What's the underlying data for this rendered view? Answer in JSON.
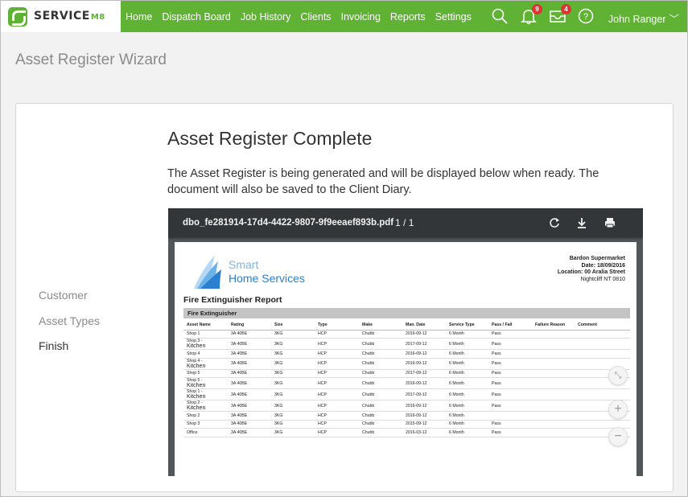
{
  "brand": {
    "name": "SERVICE",
    "suffix": "M8"
  },
  "nav": {
    "items": [
      "Home",
      "Dispatch Board",
      "Job History",
      "Clients",
      "Invoicing",
      "Reports",
      "Settings"
    ],
    "notifications_count": "9",
    "messages_count": "4",
    "user_name": "John Ranger",
    "chevron": "﹀"
  },
  "page": {
    "title": "Asset Register Wizard"
  },
  "wizard": {
    "steps": [
      "Customer",
      "Asset Types",
      "Finish"
    ],
    "active_step": "Finish",
    "heading": "Asset Register Complete",
    "description": "The Asset Register is being generated and will be displayed below when ready. The document will also be saved to the Client Diary."
  },
  "viewer": {
    "filename": "dbo_fe281914-17d4-4422-9807-9f9eeaef893b.pdf",
    "page_current": "1",
    "page_total": "1",
    "page_separator": "/",
    "zoom_in": "+",
    "zoom_out": "−"
  },
  "report": {
    "company_line1": "Smart",
    "company_line2": "Home Services",
    "client_name": "Bardon Supermarket",
    "date": "Date: 18/09/2016",
    "location": "Location: 00 Aralia Street",
    "location_line2": "Nightcliff NT 0810",
    "title": "Fire Extinguisher Report",
    "section": "Fire Extinguisher",
    "columns": [
      "Asset Name",
      "Rating",
      "Size",
      "Type",
      "Make",
      "Man. Date",
      "Service Type",
      "Pass / Fail",
      "Failure Reason",
      "Comment"
    ],
    "rows": [
      [
        "Shop 1",
        "",
        "3A 40BE",
        "3KG",
        "HCP",
        "Chubb",
        "2016-09-12",
        "6 Month",
        "Pass"
      ],
      [
        "Shop 3 -",
        "Kitchen",
        "3A 40BE",
        "3KG",
        "HCP",
        "Chubb",
        "2017-09-12",
        "6 Month",
        "Pass"
      ],
      [
        "Shop 4",
        "",
        "3A 40BE",
        "3KG",
        "HCP",
        "Chubb",
        "2016-09-12",
        "6 Month",
        "Pass"
      ],
      [
        "Shop 4 -",
        "Kitchen",
        "3A 40BE",
        "3KG",
        "HCP",
        "Chubb",
        "2016-09-12",
        "6 Month",
        "Pass"
      ],
      [
        "Shop 5",
        "",
        "3A 40BE",
        "3KG",
        "HCP",
        "Chubb",
        "2017-09-12",
        "6 Month",
        "Pass"
      ],
      [
        "Shop 5 -",
        "Kitchen",
        "3A 40BE",
        "3KG",
        "HCP",
        "Chubb",
        "2016-09-12",
        "6 Month",
        "Pass"
      ],
      [
        "Shop 1 -",
        "Kitchen",
        "3A 40BE",
        "3KG",
        "HCP",
        "Chubb",
        "2017-09-12",
        "6 Month",
        "Pass"
      ],
      [
        "Shop 2 -",
        "Kitchen",
        "3A 40BE",
        "3KG",
        "HCP",
        "Chubb",
        "2016-09-12",
        "6 Month",
        "Pass"
      ],
      [
        "Shop 2",
        "",
        "3A 40BE",
        "3KG",
        "HCP",
        "Chubb",
        "2016-09-12",
        "6 Month",
        ""
      ],
      [
        "Shop 3",
        "",
        "3A 40BE",
        "3KG",
        "HCP",
        "Chubb",
        "2015-09-12",
        "6 Month",
        "Pass"
      ],
      [
        "Office",
        "",
        "3A 40BE",
        "3KG",
        "HCP",
        "Chubb",
        "2016-03-12",
        "6 Month",
        "Pass"
      ]
    ]
  },
  "colors": {
    "brand_green": "#5fb233",
    "badge_red": "#e03333",
    "viewer_bar": "#323639"
  }
}
